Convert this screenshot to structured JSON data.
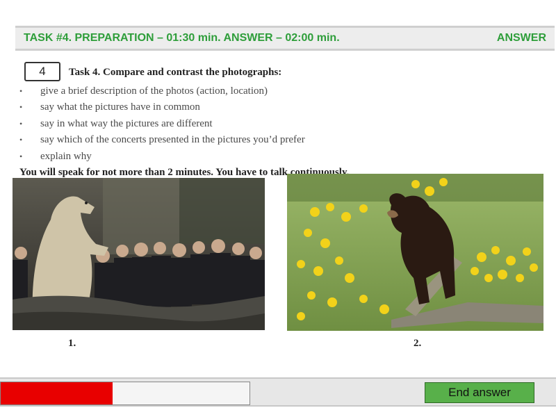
{
  "header": {
    "title": "TASK #4. PREPARATION – 01:30 min. ANSWER – 02:00 min.",
    "mode": "ANSWER"
  },
  "task": {
    "number": "4",
    "title": "Task 4. Compare and contrast the photographs:",
    "bullets": [
      "give a brief description of the photos (action, location)",
      "say what the pictures have in common",
      "say in what way the pictures are different",
      "say which of the concerts presented in the pictures you’d prefer",
      "explain why"
    ],
    "note": "You will speak for not more than 2 minutes. You have to talk continuously."
  },
  "photos": [
    {
      "caption": "1."
    },
    {
      "caption": "2."
    }
  ],
  "footer": {
    "progress": 0.45,
    "progress_color": "#e80000",
    "end_button_label": "End answer"
  },
  "colors": {
    "accent": "#2e9e3a",
    "button": "#58b04a"
  }
}
